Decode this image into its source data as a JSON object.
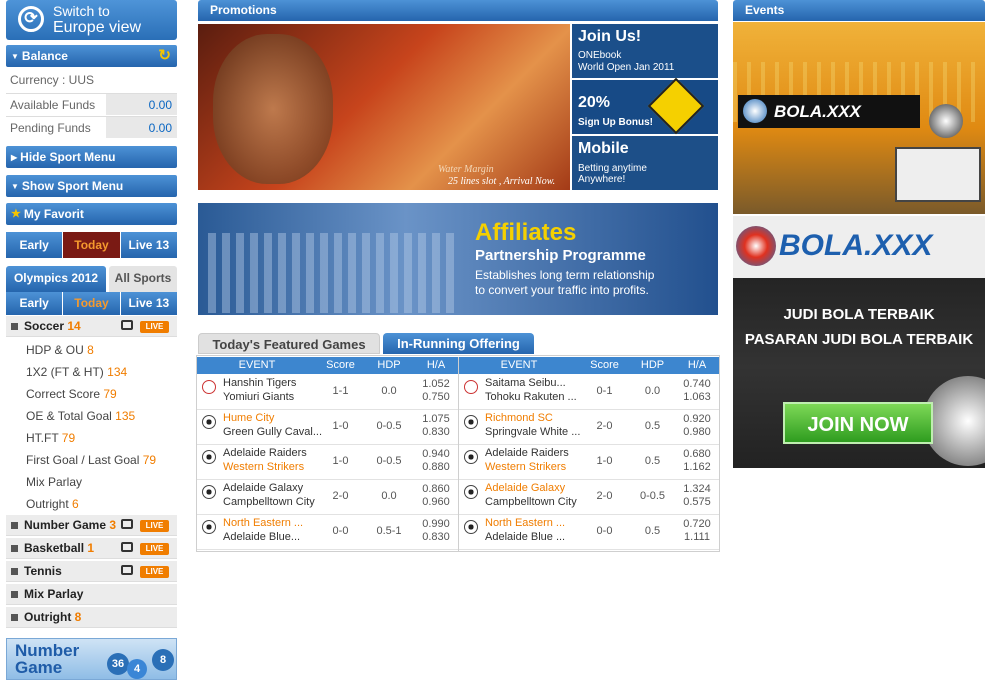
{
  "switch": {
    "line1": "Switch to",
    "line2": "Europe view"
  },
  "balance": {
    "title": "Balance",
    "currency_label": "Currency : UUS",
    "available_label": "Available Funds",
    "available_value": "0.00",
    "pending_label": "Pending Funds",
    "pending_value": "0.00"
  },
  "menu": {
    "hide_sport": "Hide Sport Menu",
    "show_sport": "Show Sport Menu",
    "favorit": "My Favorit"
  },
  "top_tabs": [
    "Early",
    "Today",
    "Live 13"
  ],
  "sub_tabs": {
    "olympics": "Olympics 2012",
    "all": "All Sports"
  },
  "inner_tabs": [
    "Early",
    "Today",
    "Live 13"
  ],
  "soccer": {
    "name": "Soccer",
    "count": "14",
    "live": "LIVE",
    "items": [
      {
        "label": "HDP & OU",
        "count": "8"
      },
      {
        "label": "1X2 (FT & HT)",
        "count": "134"
      },
      {
        "label": "Correct Score",
        "count": "79"
      },
      {
        "label": "OE & Total Goal",
        "count": "135"
      },
      {
        "label": "HT.FT",
        "count": "79"
      },
      {
        "label": "First Goal / Last Goal",
        "count": "79"
      },
      {
        "label": "Mix Parlay",
        "count": ""
      },
      {
        "label": "Outright",
        "count": "6"
      }
    ]
  },
  "sports": [
    {
      "name": "Number Game",
      "count": "3",
      "live": "LIVE"
    },
    {
      "name": "Basketball",
      "count": "1",
      "live": "LIVE"
    },
    {
      "name": "Tennis",
      "count": "",
      "live": "LIVE"
    },
    {
      "name": "Mix Parlay",
      "count": "",
      "live": ""
    },
    {
      "name": "Outright",
      "count": "8",
      "live": ""
    }
  ],
  "number_game_banner": {
    "line1": "Number",
    "line2": "Game",
    "nums": [
      "36",
      "4",
      "8"
    ]
  },
  "promotions": {
    "title": "Promotions",
    "main_caption1": "Water Margin",
    "main_caption2": "25 lines slot , Arrival Now.",
    "side": [
      {
        "a": "Join Us!",
        "b1": "ONEbook",
        "b2": "World Open Jan 2011"
      },
      {
        "a": "20%",
        "b1": "Sign Up Bonus!",
        "b2": ""
      },
      {
        "a": "Mobile",
        "b1": "Betting anytime",
        "b2": "Anywhere!"
      }
    ],
    "affiliates": {
      "title": "Affiliates",
      "subtitle": "Partnership Programme",
      "desc1": "Establishes long term relationship",
      "desc2": "to convert your traffic into profits."
    }
  },
  "games": {
    "tab1": "Today's Featured Games",
    "tab2": "In-Running Offering",
    "cols": [
      "EVENT",
      "Score",
      "HDP",
      "H/A"
    ],
    "left": [
      {
        "ball": "baseball",
        "t1": "Hanshin Tigers",
        "t2": "Yomiuri Giants",
        "o1": false,
        "o2": false,
        "score": "1-1",
        "hdp": "0.0",
        "ha1": "1.052",
        "ha2": "0.750"
      },
      {
        "ball": "soccer",
        "t1": "Hume City",
        "t2": "Green Gully Caval...",
        "o1": true,
        "o2": false,
        "score": "1-0",
        "hdp": "0-0.5",
        "ha1": "1.075",
        "ha2": "0.830"
      },
      {
        "ball": "soccer",
        "t1": "Adelaide Raiders",
        "t2": "Western Strikers",
        "o1": false,
        "o2": true,
        "score": "1-0",
        "hdp": "0-0.5",
        "ha1": "0.940",
        "ha2": "0.880"
      },
      {
        "ball": "soccer",
        "t1": "Adelaide Galaxy",
        "t2": "Campbelltown City",
        "o1": false,
        "o2": false,
        "score": "2-0",
        "hdp": "0.0",
        "ha1": "0.860",
        "ha2": "0.960"
      },
      {
        "ball": "soccer",
        "t1": "North Eastern ...",
        "t2": "Adelaide Blue...",
        "o1": true,
        "o2": false,
        "score": "0-0",
        "hdp": "0.5-1",
        "ha1": "0.990",
        "ha2": "0.830"
      }
    ],
    "right": [
      {
        "ball": "baseball",
        "t1": "Saitama Seibu...",
        "t2": "Tohoku Rakuten ...",
        "o1": false,
        "o2": false,
        "score": "0-1",
        "hdp": "0.0",
        "ha1": "0.740",
        "ha2": "1.063"
      },
      {
        "ball": "soccer",
        "t1": "Richmond SC",
        "t2": "Springvale White ...",
        "o1": true,
        "o2": false,
        "score": "2-0",
        "hdp": "0.5",
        "ha1": "0.920",
        "ha2": "0.980"
      },
      {
        "ball": "soccer",
        "t1": "Adelaide Raiders",
        "t2": "Western Strikers",
        "o1": false,
        "o2": true,
        "score": "1-0",
        "hdp": "0.5",
        "ha1": "0.680",
        "ha2": "1.162"
      },
      {
        "ball": "soccer",
        "t1": "Adelaide Galaxy",
        "t2": "Campbelltown City",
        "o1": true,
        "o2": false,
        "score": "2-0",
        "hdp": "0-0.5",
        "ha1": "1.324",
        "ha2": "0.575"
      },
      {
        "ball": "soccer",
        "t1": "North Eastern ...",
        "t2": "Adelaide Blue ...",
        "o1": true,
        "o2": false,
        "score": "0-0",
        "hdp": "0.5",
        "ha1": "0.720",
        "ha2": "1.111"
      }
    ]
  },
  "events": {
    "title": "Events",
    "brand": "BOLA.XXX",
    "brand2": "BOLA.XXX",
    "line1": "JUDI BOLA TERBAIK",
    "line2": "PASARAN JUDI BOLA TERBAIK",
    "join": "JOIN NOW"
  },
  "colors": {
    "accent": "#2a6fb7",
    "orange": "#f07d00",
    "dark_red": "#7a1a14"
  }
}
